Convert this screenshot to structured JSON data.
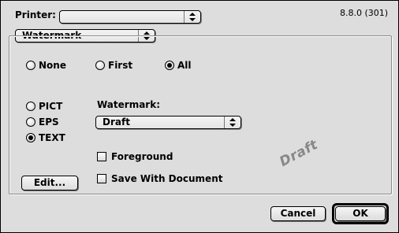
{
  "printer": {
    "label": "Printer:",
    "value": ""
  },
  "version": "8.8.0 (301)",
  "section_popup": {
    "value": "Watermark"
  },
  "pages": {
    "options": [
      {
        "label": "None",
        "selected": false
      },
      {
        "label": "First",
        "selected": false
      },
      {
        "label": "All",
        "selected": true
      }
    ]
  },
  "format": {
    "options": [
      {
        "label": "PICT",
        "selected": false
      },
      {
        "label": "EPS",
        "selected": false
      },
      {
        "label": "TEXT",
        "selected": true
      }
    ]
  },
  "watermark": {
    "label": "Watermark:",
    "value": "Draft"
  },
  "foreground": {
    "label": "Foreground",
    "checked": false
  },
  "save_with_doc": {
    "label": "Save With Document",
    "checked": false
  },
  "preview_text": "Draft",
  "buttons": {
    "edit": "Edit...",
    "cancel": "Cancel",
    "ok": "OK"
  }
}
